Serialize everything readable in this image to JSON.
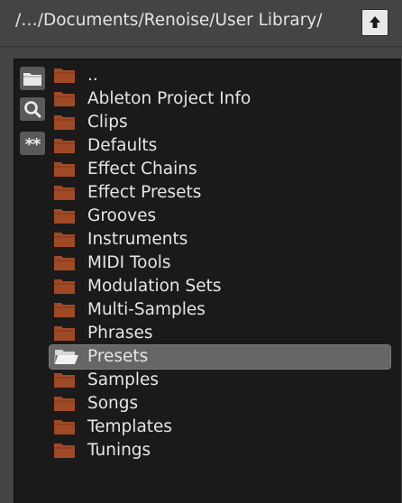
{
  "path_bar": {
    "path": "/…/Documents/Renoise/User Library/",
    "up_icon": "up-arrow-icon"
  },
  "toolbar": {
    "folder_icon": "folder-icon",
    "search_icon": "search-icon",
    "stars_label": "**"
  },
  "colors": {
    "background": "#444444",
    "panel": "#1a1a1a",
    "folder": "#a04a25",
    "selected_row": "#666666",
    "text": "#e6e6e6"
  },
  "folders": [
    {
      "label": "..",
      "selected": false
    },
    {
      "label": "Ableton Project Info",
      "selected": false
    },
    {
      "label": "Clips",
      "selected": false
    },
    {
      "label": "Defaults",
      "selected": false
    },
    {
      "label": "Effect Chains",
      "selected": false
    },
    {
      "label": "Effect Presets",
      "selected": false
    },
    {
      "label": "Grooves",
      "selected": false
    },
    {
      "label": "Instruments",
      "selected": false
    },
    {
      "label": "MIDI Tools",
      "selected": false
    },
    {
      "label": "Modulation Sets",
      "selected": false
    },
    {
      "label": "Multi-Samples",
      "selected": false
    },
    {
      "label": "Phrases",
      "selected": false
    },
    {
      "label": "Presets",
      "selected": true
    },
    {
      "label": "Samples",
      "selected": false
    },
    {
      "label": "Songs",
      "selected": false
    },
    {
      "label": "Templates",
      "selected": false
    },
    {
      "label": "Tunings",
      "selected": false
    }
  ]
}
